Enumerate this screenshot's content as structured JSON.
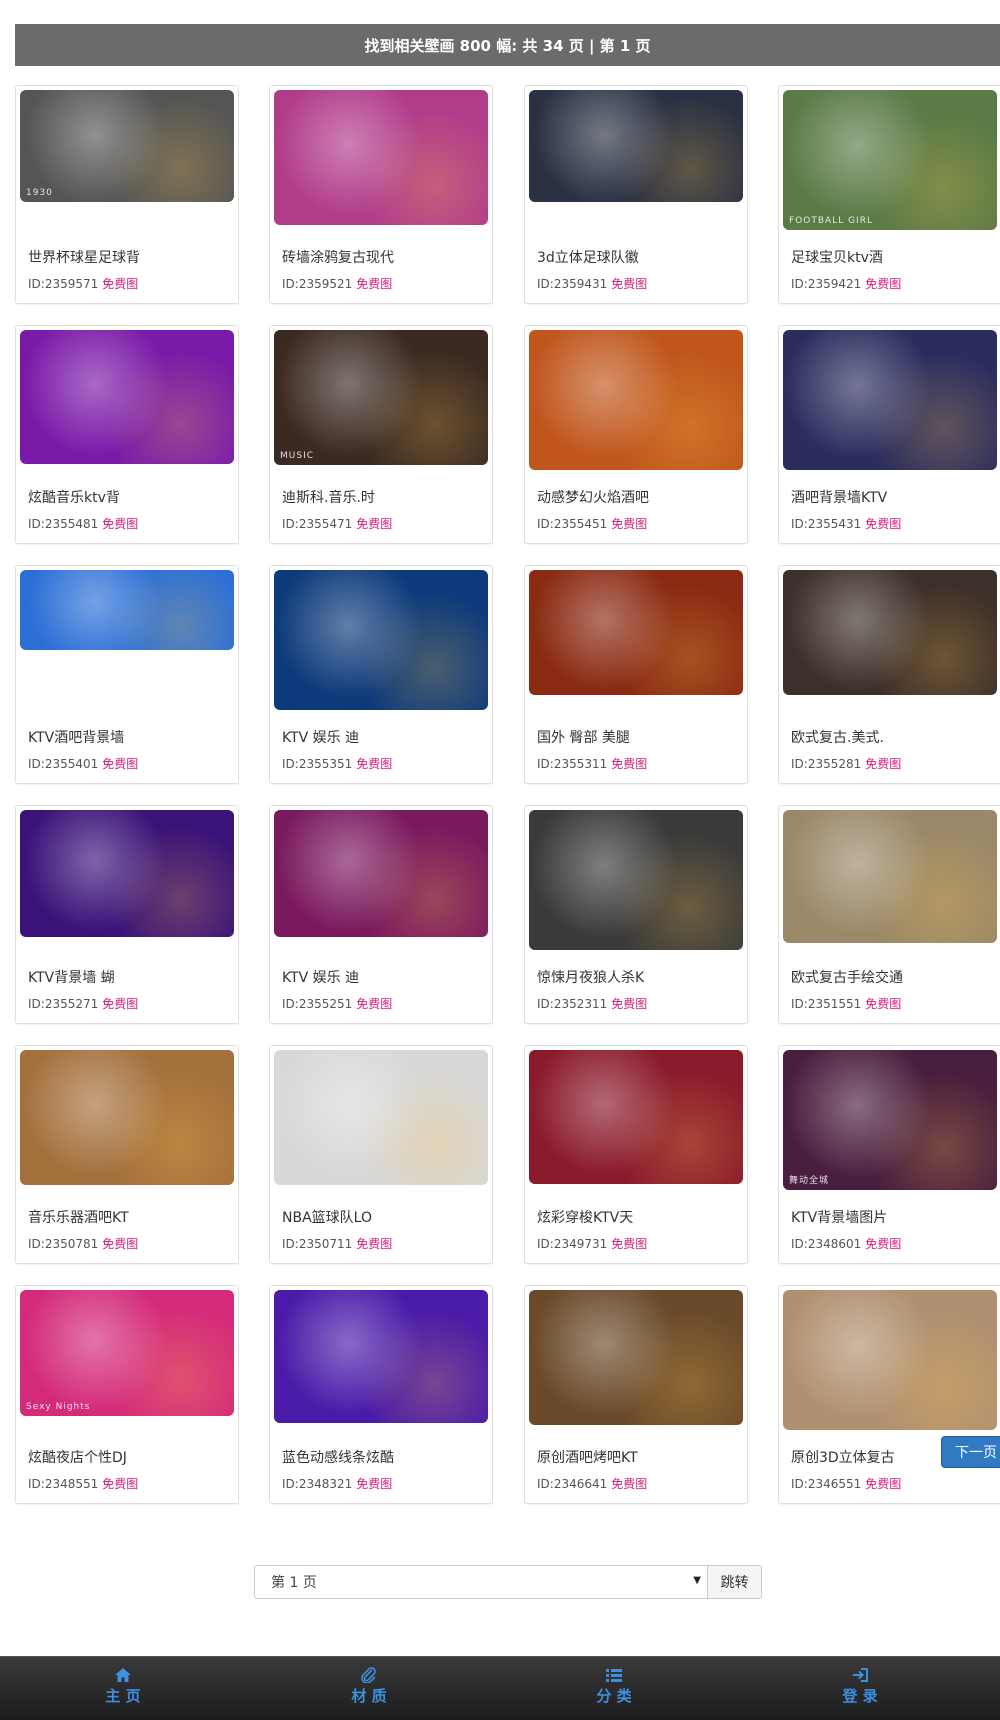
{
  "header": {
    "summary": "找到相关壁画 800 幅: 共 34 页 | 第 1 页"
  },
  "free_label": "免费图",
  "cards": [
    {
      "title": "世界杯球星足球背",
      "id": "ID:2359571",
      "bg": "#555555",
      "thumb_text": "1930"
    },
    {
      "title": "砖墙涂鸦复古现代",
      "id": "ID:2359521",
      "bg": "#b13c8a",
      "thumb_text": ""
    },
    {
      "title": "3d立体足球队徽",
      "id": "ID:2359431",
      "bg": "#2a3142",
      "thumb_text": ""
    },
    {
      "title": "足球宝贝ktv酒",
      "id": "ID:2359421",
      "bg": "#5a7a46",
      "thumb_text": "FOOTBALL GIRL"
    },
    {
      "title": "炫酷音乐ktv背",
      "id": "ID:2355481",
      "bg": "#7a1aa8",
      "thumb_text": ""
    },
    {
      "title": "迪斯科.音乐.时",
      "id": "ID:2355471",
      "bg": "#3b2a22",
      "thumb_text": "MUSIC"
    },
    {
      "title": "动感梦幻火焰酒吧",
      "id": "ID:2355451",
      "bg": "#c0561c",
      "thumb_text": ""
    },
    {
      "title": "酒吧背景墙KTV",
      "id": "ID:2355431",
      "bg": "#2b2d5e",
      "thumb_text": ""
    },
    {
      "title": "KTV酒吧背景墙",
      "id": "ID:2355401",
      "bg": "#2b6fd6",
      "thumb_text": ""
    },
    {
      "title": "KTV 娱乐 迪",
      "id": "ID:2355351",
      "bg": "#0d3a7a",
      "thumb_text": ""
    },
    {
      "title": "国外 臀部 美腿",
      "id": "ID:2355311",
      "bg": "#8a2a12",
      "thumb_text": ""
    },
    {
      "title": "欧式复古.美式.",
      "id": "ID:2355281",
      "bg": "#3d2f2a",
      "thumb_text": ""
    },
    {
      "title": "KTV背景墙 蝴",
      "id": "ID:2355271",
      "bg": "#3a1278",
      "thumb_text": ""
    },
    {
      "title": "KTV 娱乐 迪",
      "id": "ID:2355251",
      "bg": "#7a1a5e",
      "thumb_text": ""
    },
    {
      "title": "惊悚月夜狼人杀K",
      "id": "ID:2352311",
      "bg": "#3a3a3a",
      "thumb_text": ""
    },
    {
      "title": "欧式复古手绘交通",
      "id": "ID:2351551",
      "bg": "#9a8868",
      "thumb_text": ""
    },
    {
      "title": "音乐乐器酒吧KT",
      "id": "ID:2350781",
      "bg": "#a4703c",
      "thumb_text": ""
    },
    {
      "title": "NBA篮球队LO",
      "id": "ID:2350711",
      "bg": "#d8d8d8",
      "thumb_text": ""
    },
    {
      "title": "炫彩穿梭KTV天",
      "id": "ID:2349731",
      "bg": "#8a1a2c",
      "thumb_text": ""
    },
    {
      "title": "KTV背景墙图片",
      "id": "ID:2348601",
      "bg": "#4a1e3e",
      "thumb_text": "舞动全城"
    },
    {
      "title": "炫酷夜店个性DJ",
      "id": "ID:2348551",
      "bg": "#d42a7a",
      "thumb_text": "Sexy Nights"
    },
    {
      "title": "蓝色动感线条炫酷",
      "id": "ID:2348321",
      "bg": "#4a1aa8",
      "thumb_text": ""
    },
    {
      "title": "原创酒吧烤吧KT",
      "id": "ID:2346641",
      "bg": "#6a4a2a",
      "thumb_text": ""
    },
    {
      "title": "原创3D立体复古",
      "id": "ID:2346551",
      "bg": "#b09070",
      "thumb_text": ""
    }
  ],
  "next_page": "下一页",
  "pager": {
    "current": "第 1 页",
    "go": "跳转"
  },
  "bottom_nav": [
    {
      "label": "主 页",
      "icon": "home-icon"
    },
    {
      "label": "材 质",
      "icon": "paperclip-icon"
    },
    {
      "label": "分 类",
      "icon": "list-icon"
    },
    {
      "label": "登 录",
      "icon": "login-icon"
    }
  ],
  "colors": {
    "accent": "#2f7ac3",
    "free": "#d6197a",
    "topbar": "#6b6b6b",
    "nav_text": "#3d8fe0"
  }
}
